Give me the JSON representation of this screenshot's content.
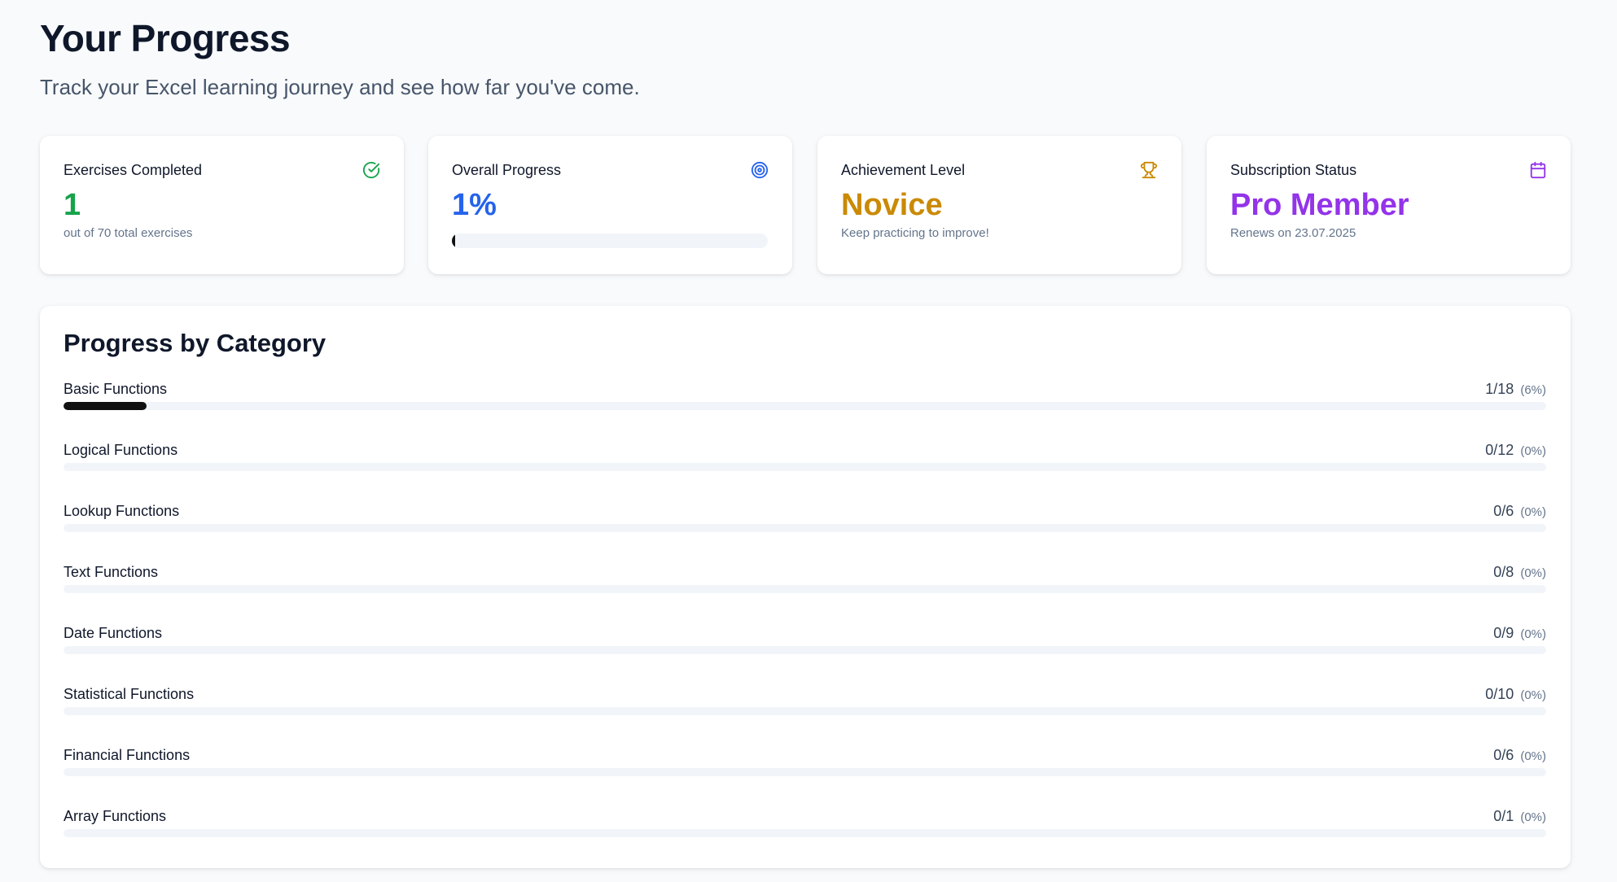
{
  "header": {
    "title": "Your Progress",
    "subtitle": "Track your Excel learning journey and see how far you've come."
  },
  "stats": {
    "exercises": {
      "title": "Exercises Completed",
      "value": "1",
      "sub": "out of 70 total exercises",
      "icon": "check-circle-icon",
      "color": "#16a34a"
    },
    "overall": {
      "title": "Overall Progress",
      "value": "1%",
      "progress": 0.01,
      "icon": "target-icon",
      "color": "#2563eb"
    },
    "achievement": {
      "title": "Achievement Level",
      "value": "Novice",
      "sub": "Keep practicing to improve!",
      "icon": "trophy-icon",
      "color": "#ca8a04"
    },
    "subscription": {
      "title": "Subscription Status",
      "value": "Pro Member",
      "sub": "Renews on 23.07.2025",
      "icon": "calendar-icon",
      "color": "#9333ea"
    }
  },
  "categories": {
    "title": "Progress by Category",
    "items": [
      {
        "name": "Basic Functions",
        "count": "1/18",
        "pct": "(6%)",
        "progress": 0.056
      },
      {
        "name": "Logical Functions",
        "count": "0/12",
        "pct": "(0%)",
        "progress": 0
      },
      {
        "name": "Lookup Functions",
        "count": "0/6",
        "pct": "(0%)",
        "progress": 0
      },
      {
        "name": "Text Functions",
        "count": "0/8",
        "pct": "(0%)",
        "progress": 0
      },
      {
        "name": "Date Functions",
        "count": "0/9",
        "pct": "(0%)",
        "progress": 0
      },
      {
        "name": "Statistical Functions",
        "count": "0/10",
        "pct": "(0%)",
        "progress": 0
      },
      {
        "name": "Financial Functions",
        "count": "0/6",
        "pct": "(0%)",
        "progress": 0
      },
      {
        "name": "Array Functions",
        "count": "0/1",
        "pct": "(0%)",
        "progress": 0
      }
    ]
  }
}
